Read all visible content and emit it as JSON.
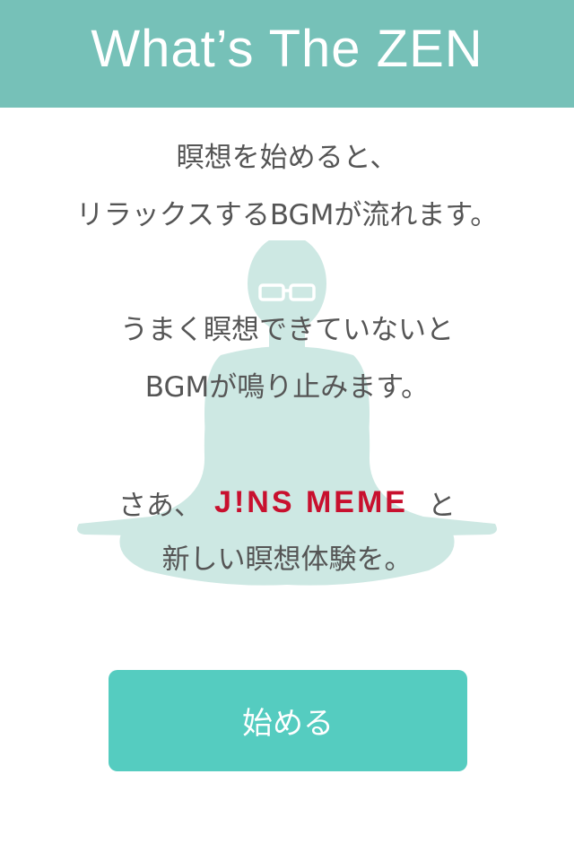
{
  "header": {
    "title": "What’s The ZEN"
  },
  "intro": {
    "lines": [
      "瞑想を始めると、",
      "リラックスするBGMが流れます。",
      "うまく瞑想できていないと",
      "BGMが鳴り止みます。"
    ],
    "brand_prefix": "さあ、",
    "brand_logo": "J!NS MEME",
    "brand_suffix": "と",
    "closing": "新しい瞑想体験を。"
  },
  "start_button": {
    "label": "始める"
  },
  "colors": {
    "header_bg": "#76c1b8",
    "button_bg": "#55ccc0",
    "silhouette": "#cde8e3",
    "brand_red": "#c8102e",
    "text": "#555555"
  },
  "icons": {
    "figure": "meditating-person-with-glasses"
  }
}
